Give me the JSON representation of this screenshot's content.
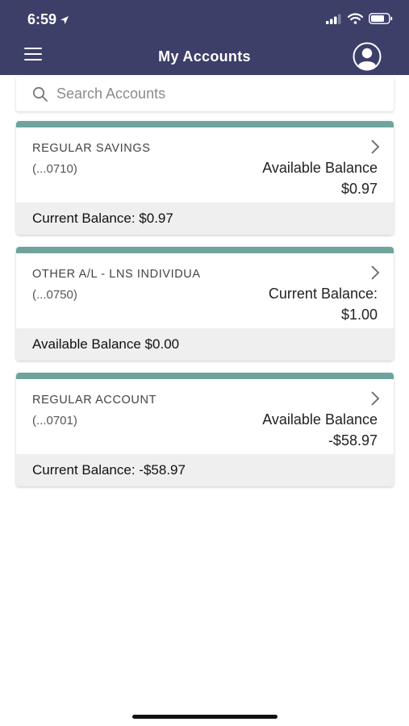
{
  "status_bar": {
    "time": "6:59"
  },
  "header": {
    "title": "My Accounts"
  },
  "search": {
    "placeholder": "Search Accounts"
  },
  "accounts": [
    {
      "name": "REGULAR SAVINGS",
      "number": "(...0710)",
      "balance_label": "Available Balance",
      "balance_value": "$0.97",
      "footer": "Current Balance: $0.97"
    },
    {
      "name": "OTHER A/L - LNS INDIVIDUA",
      "number": "(...0750)",
      "balance_label": "Current Balance:",
      "balance_value": "$1.00",
      "footer": "Available Balance $0.00"
    },
    {
      "name": "REGULAR ACCOUNT",
      "number": "(...0701)",
      "balance_label": "Available Balance",
      "balance_value": "-$58.97",
      "footer": "Current Balance: -$58.97"
    }
  ],
  "colors": {
    "header_bg": "#3c3f68",
    "accent_bar": "#6ea49c",
    "footer_bg": "#efefef"
  },
  "icons": [
    "location-arrow-icon",
    "signal-icon",
    "wifi-icon",
    "battery-icon",
    "menu-icon",
    "profile-icon",
    "search-icon",
    "chevron-right-icon"
  ]
}
